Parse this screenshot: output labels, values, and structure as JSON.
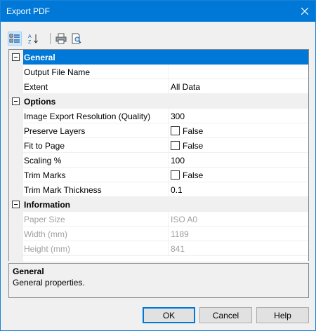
{
  "window": {
    "title": "Export PDF",
    "close_icon": "close-icon"
  },
  "toolbar": {
    "buttons": [
      "categorized-icon",
      "alphabetical-sort-icon",
      "print-icon",
      "print-preview-icon"
    ]
  },
  "properties": {
    "general": {
      "label": "General",
      "output_file_name": {
        "name": "Output File Name",
        "value": ""
      },
      "extent": {
        "name": "Extent",
        "value": "All Data"
      }
    },
    "options": {
      "label": "Options",
      "resolution": {
        "name": "Image Export Resolution (Quality)",
        "value": "300"
      },
      "preserve_layers": {
        "name": "Preserve Layers",
        "value": "False"
      },
      "fit_to_page": {
        "name": "Fit to Page",
        "value": "False"
      },
      "scaling": {
        "name": "Scaling %",
        "value": "100"
      },
      "trim_marks": {
        "name": "Trim Marks",
        "value": "False"
      },
      "trim_mark_thickness": {
        "name": "Trim Mark Thickness",
        "value": "0.1"
      }
    },
    "information": {
      "label": "Information",
      "paper_size": {
        "name": "Paper Size",
        "value": "ISO A0"
      },
      "width": {
        "name": "Width (mm)",
        "value": "1189"
      },
      "height": {
        "name": "Height (mm)",
        "value": "841"
      }
    }
  },
  "help": {
    "title": "General",
    "description": "General properties."
  },
  "buttons": {
    "ok": "OK",
    "cancel": "Cancel",
    "help": "Help"
  },
  "colors": {
    "accent": "#0078d7",
    "selection": "#0078d7",
    "disabled_text": "#a0a0a0"
  }
}
